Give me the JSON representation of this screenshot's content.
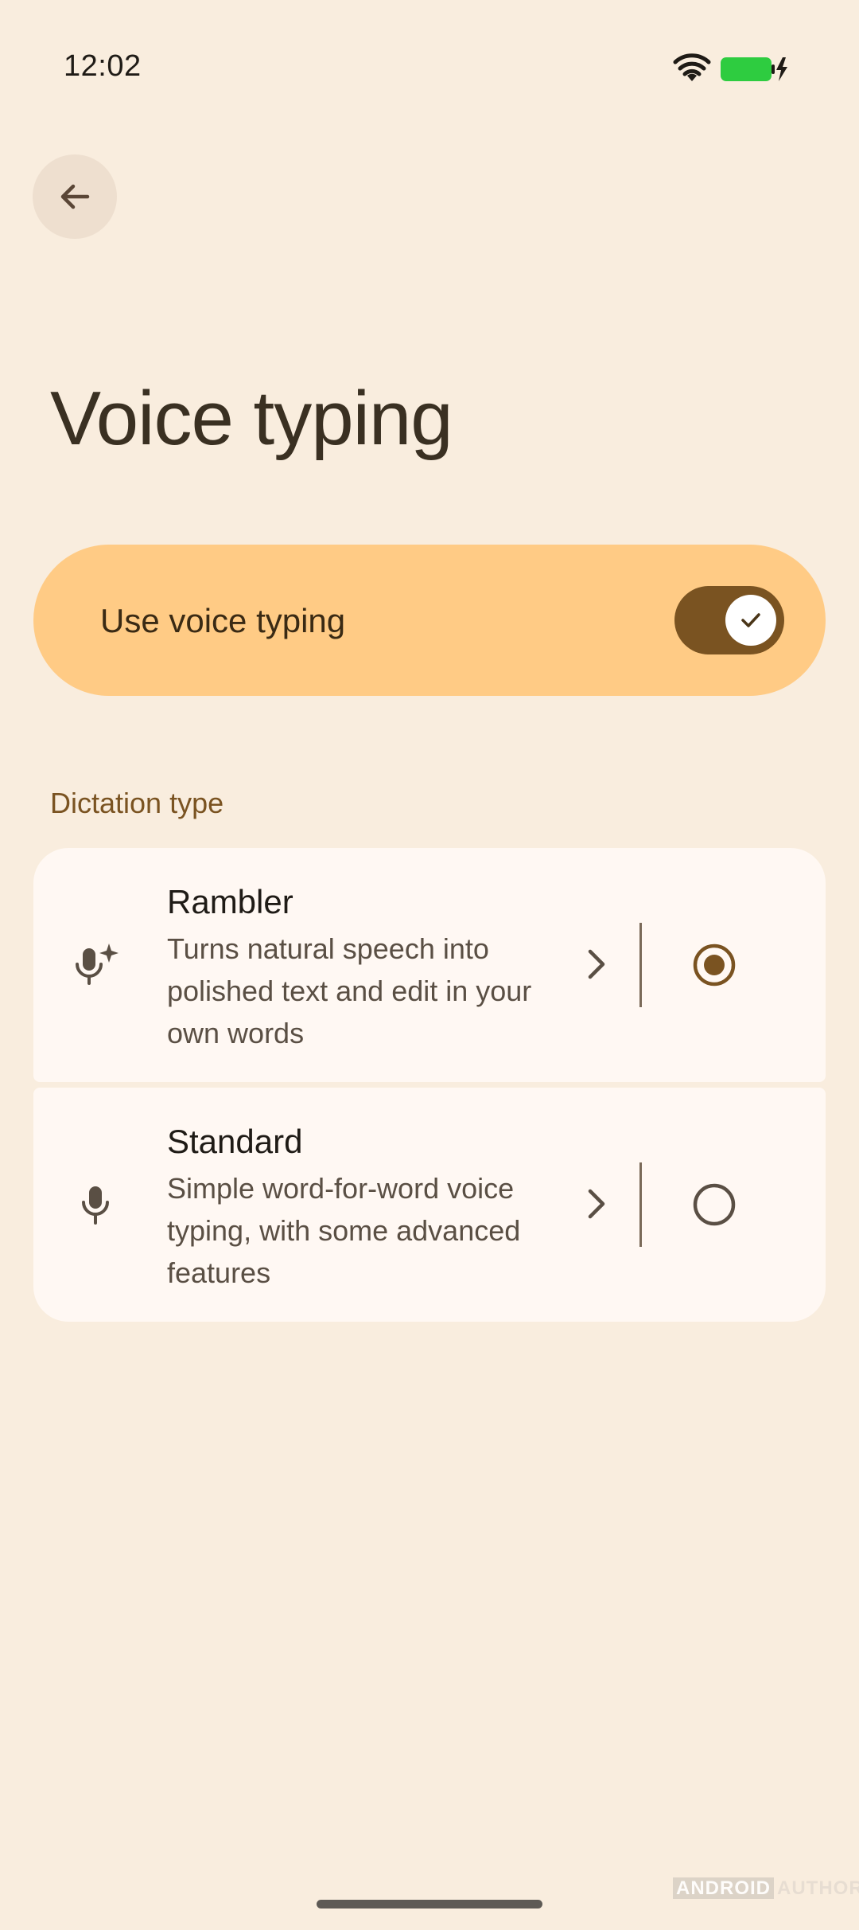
{
  "status_bar": {
    "time": "12:02",
    "icons": [
      "wifi-icon",
      "battery-charging-icon"
    ],
    "battery_color": "#2ECC40"
  },
  "navigation": {
    "back_icon": "arrow-back-icon"
  },
  "page": {
    "title": "Voice typing"
  },
  "master_switch": {
    "label": "Use voice typing",
    "checked": true
  },
  "dictation": {
    "section_title": "Dictation type",
    "options": [
      {
        "icon": "mic-sparkle-icon",
        "title": "Rambler",
        "description": "Turns natural speech into polished text and edit in your own words",
        "selected": true
      },
      {
        "icon": "mic-icon",
        "title": "Standard",
        "description": "Simple word-for-word voice typing, with some advanced features",
        "selected": false
      }
    ]
  },
  "watermark": {
    "box_text": "ANDROID",
    "text": "AUTHORITY"
  },
  "colors": {
    "background": "#F9EDDE",
    "accent": "#7A5321",
    "switch_container": "#FFCB85",
    "card": "#FFF8F3"
  }
}
